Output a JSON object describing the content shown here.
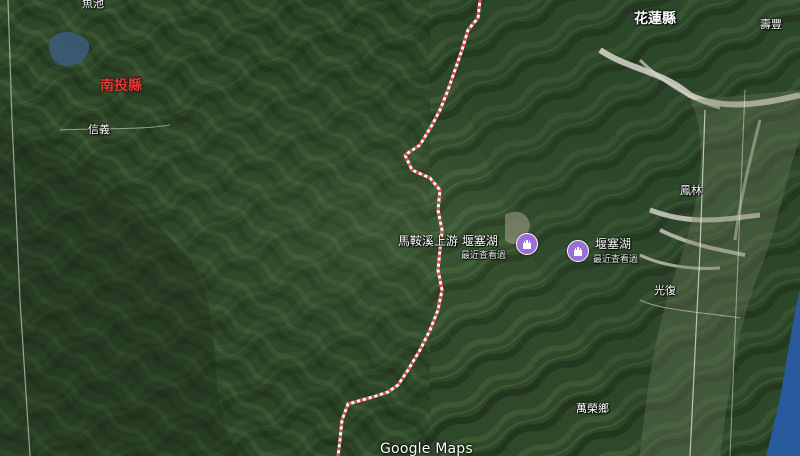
{
  "map": {
    "colors": {
      "forest": "#2f4a2a",
      "ridge": "#4a6a3c",
      "shadow": "#1c2a18",
      "river": "#d9d6cc",
      "boundary": "#e04a4a",
      "pin": "#9c6fd6",
      "sea": "#2a5a9e"
    },
    "labels": {
      "county_nantou": "南投縣",
      "county_hualien": "花蓮縣",
      "xinyi": "信義",
      "shoufeng": "壽豐",
      "fenglin": "鳳林",
      "guangfu": "光復",
      "wanrong": "萬榮鄉",
      "top_left_partial": "魚池"
    },
    "pins": [
      {
        "name": "馬鞍溪上游 堰塞湖",
        "subtitle": "最近查看過",
        "icon": "castle-icon"
      },
      {
        "name": "堰塞湖",
        "subtitle": "最近查看過",
        "icon": "castle-icon"
      }
    ],
    "brand": "Google Maps"
  }
}
